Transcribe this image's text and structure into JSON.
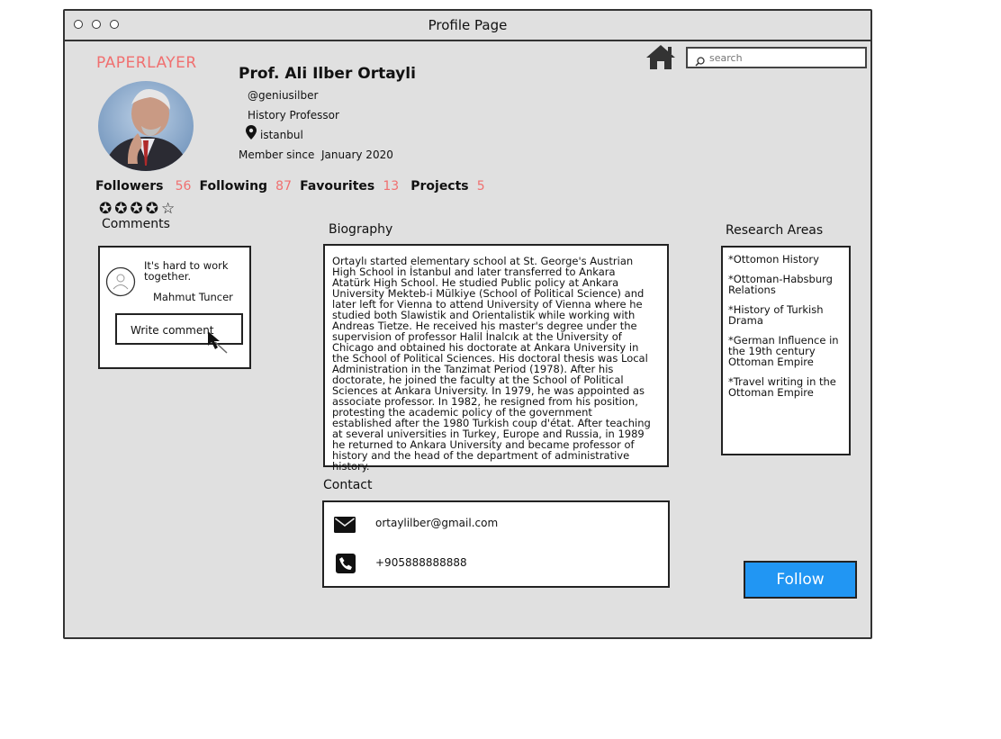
{
  "window": {
    "title": "Profile Page"
  },
  "brand": "PAPERLAYER",
  "search": {
    "placeholder": "search"
  },
  "profile": {
    "name": "Prof. Ali Ilber Ortayli",
    "handle": "@geniusilber",
    "role": "History Professor",
    "location": "istanbul",
    "member_since_label": "Member since",
    "member_since_date": "January 2020",
    "rating": 4,
    "rating_max": 5
  },
  "stats": [
    {
      "label": "Followers",
      "value": "56"
    },
    {
      "label": "Following",
      "value": "87"
    },
    {
      "label": "Favourites",
      "value": "13"
    },
    {
      "label": "Projects",
      "value": "5"
    }
  ],
  "comments": {
    "title": "Comments",
    "items": [
      {
        "text": "It's hard to work together.",
        "author": "Mahmut Tuncer"
      }
    ],
    "write_label": "Write comment"
  },
  "biography": {
    "title": "Biography",
    "text": "Ortaylı started elementary school at St. George's Austrian High School in İstanbul and later transferred to Ankara Atatürk High School. He studied Public policy at Ankara University Mekteb-i Mülkiye (School of Political Science) and later left for Vienna to attend University of Vienna where he studied both Slawistik and Orientalistik while working with Andreas Tietze. He received his master's degree under the supervision of professor Halil İnalcık at the University of Chicago and obtained his doctorate at Ankara University in the School of Political Sciences. His doctoral thesis was Local Administration in the Tanzimat Period (1978). After his doctorate, he joined the faculty at the School of Political Sciences at Ankara University. In 1979, he was appointed as associate professor. In 1982, he resigned from his position, protesting the academic policy of the government established after the 1980 Turkish coup d'état. After teaching at several universities in Turkey, Europe and Russia, in 1989 he returned to Ankara University and became professor of history and the head of the department of administrative history."
  },
  "research": {
    "title": "Research Areas",
    "items": [
      "*Ottomon History",
      "*Ottoman-Habsburg Relations",
      "*History of Turkish Drama",
      "*German Influence in the 19th century Ottoman Empire",
      "*Travel writing in the Ottoman Empire"
    ]
  },
  "contact": {
    "title": "Contact",
    "email": "ortaylilber@gmail.com",
    "phone": "+905888888888",
    "email_icon": "envelope-icon",
    "phone_icon": "phone-icon"
  },
  "follow_label": "Follow",
  "colors": {
    "accent": "#f07070",
    "follow_button": "#2196f3",
    "window_bg": "#e0e0e0"
  }
}
